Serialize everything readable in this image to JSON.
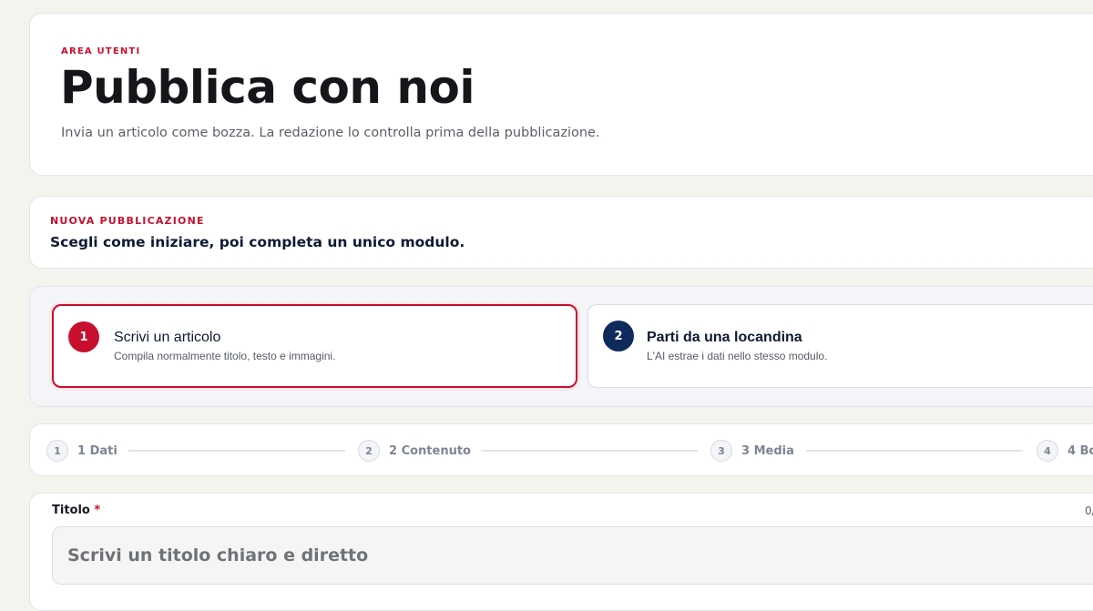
{
  "hero": {
    "eyebrow": "AREA UTENTI",
    "title": "Pubblica con noi",
    "subtitle": "Invia un articolo come bozza. La redazione lo controlla prima della pubblicazione."
  },
  "new_publication": {
    "eyebrow": "NUOVA PUBBLICAZIONE",
    "lead": "Scegli come iniziare, poi completa un unico modulo."
  },
  "choices": [
    {
      "number": "1",
      "title": "Scrivi un articolo",
      "description": "Compila normalmente titolo, testo e immagini.",
      "selected": true
    },
    {
      "number": "2",
      "title": "Parti da una locandina",
      "description": "L'AI estrae i dati nello stesso modulo.",
      "selected": false
    }
  ],
  "steps": [
    {
      "number": "1",
      "label": "1 Dati"
    },
    {
      "number": "2",
      "label": "2 Contenuto"
    },
    {
      "number": "3",
      "label": "3 Media"
    },
    {
      "number": "4",
      "label": "4 Bo"
    }
  ],
  "form": {
    "title_label": "Titolo",
    "required_mark": "*",
    "counter": "0/",
    "title_placeholder": "Scrivi un titolo chiaro e diretto",
    "title_value": ""
  },
  "colors": {
    "accent_red": "#c8102e",
    "navy": "#0e2a5c",
    "background": "#f4f4ef"
  }
}
